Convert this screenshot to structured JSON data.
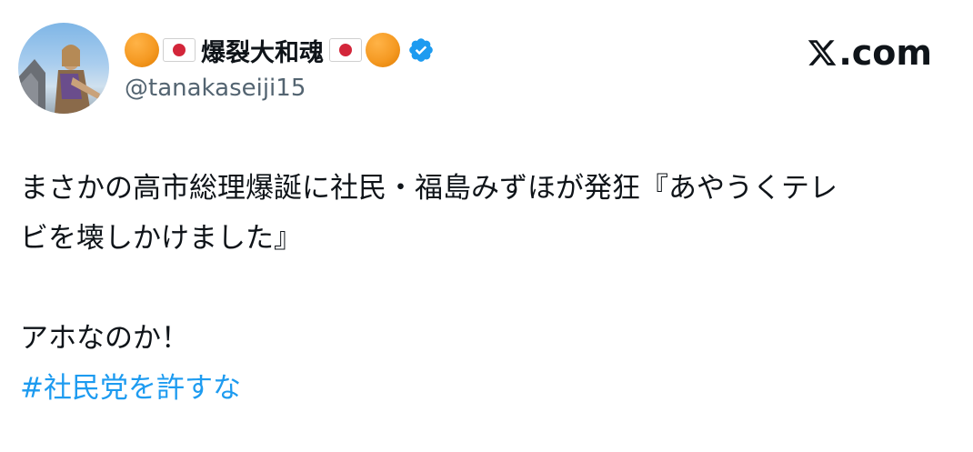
{
  "author": {
    "display_name": "爆裂大和魂",
    "handle": "@tanakaseiji15",
    "decorations": [
      "orange-circle-icon",
      "japan-flag-icon",
      "japan-flag-icon",
      "orange-circle-icon"
    ],
    "verified": true,
    "verified_color": "#1d9bf0"
  },
  "brand": {
    "label": ".com",
    "icon": "x-logo-icon"
  },
  "tweet": {
    "line1": "まさかの高市総理爆誕に社民・福島みずほが発狂『あやうくテレ",
    "line2": "ビを壊しかけました』",
    "line3": "アホなのか！",
    "hashtag": "#社民党を許すな",
    "hashtag_color": "#1d9bf0"
  }
}
